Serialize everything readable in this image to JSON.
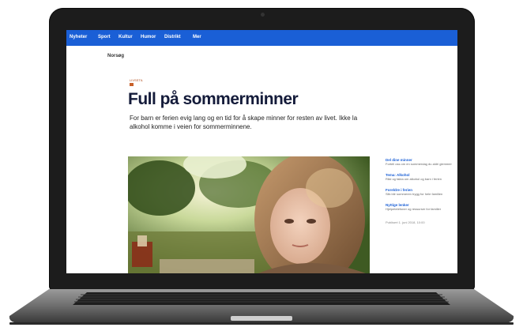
{
  "nav": {
    "items": [
      "Nyheter",
      "Sport",
      "Kultur",
      "Humor",
      "Distrikt",
      "Mer"
    ]
  },
  "subnav": {
    "label": "Norsøg"
  },
  "article": {
    "kicker": "LIVSSTIL",
    "headline": "Full på sommerminner",
    "lead": "For barn er ferien evig lang og en tid for å skape minner for resten av livet. Ikke la alkohol komme i veien for sommerminnene."
  },
  "sidebar": {
    "items": [
      {
        "title": "Del dine minner",
        "text": "Fortell oss om en sommerdag du aldri glemmer"
      },
      {
        "title": "Tema: Alkohol",
        "text": "Råd og fakta om alkohol og barn i ferien"
      },
      {
        "title": "Foreldre i ferien",
        "text": "Slik blir sommeren trygg for hele familien"
      },
      {
        "title": "Nyttige lenker",
        "text": "Hjelpetelefoner og ressurser for familier"
      }
    ],
    "footer": "Publisert 1. juni 2018, 10:00"
  },
  "colors": {
    "nav": "#1a5fd6",
    "headline": "#141b3a",
    "laptop": "#1c1c1c"
  }
}
